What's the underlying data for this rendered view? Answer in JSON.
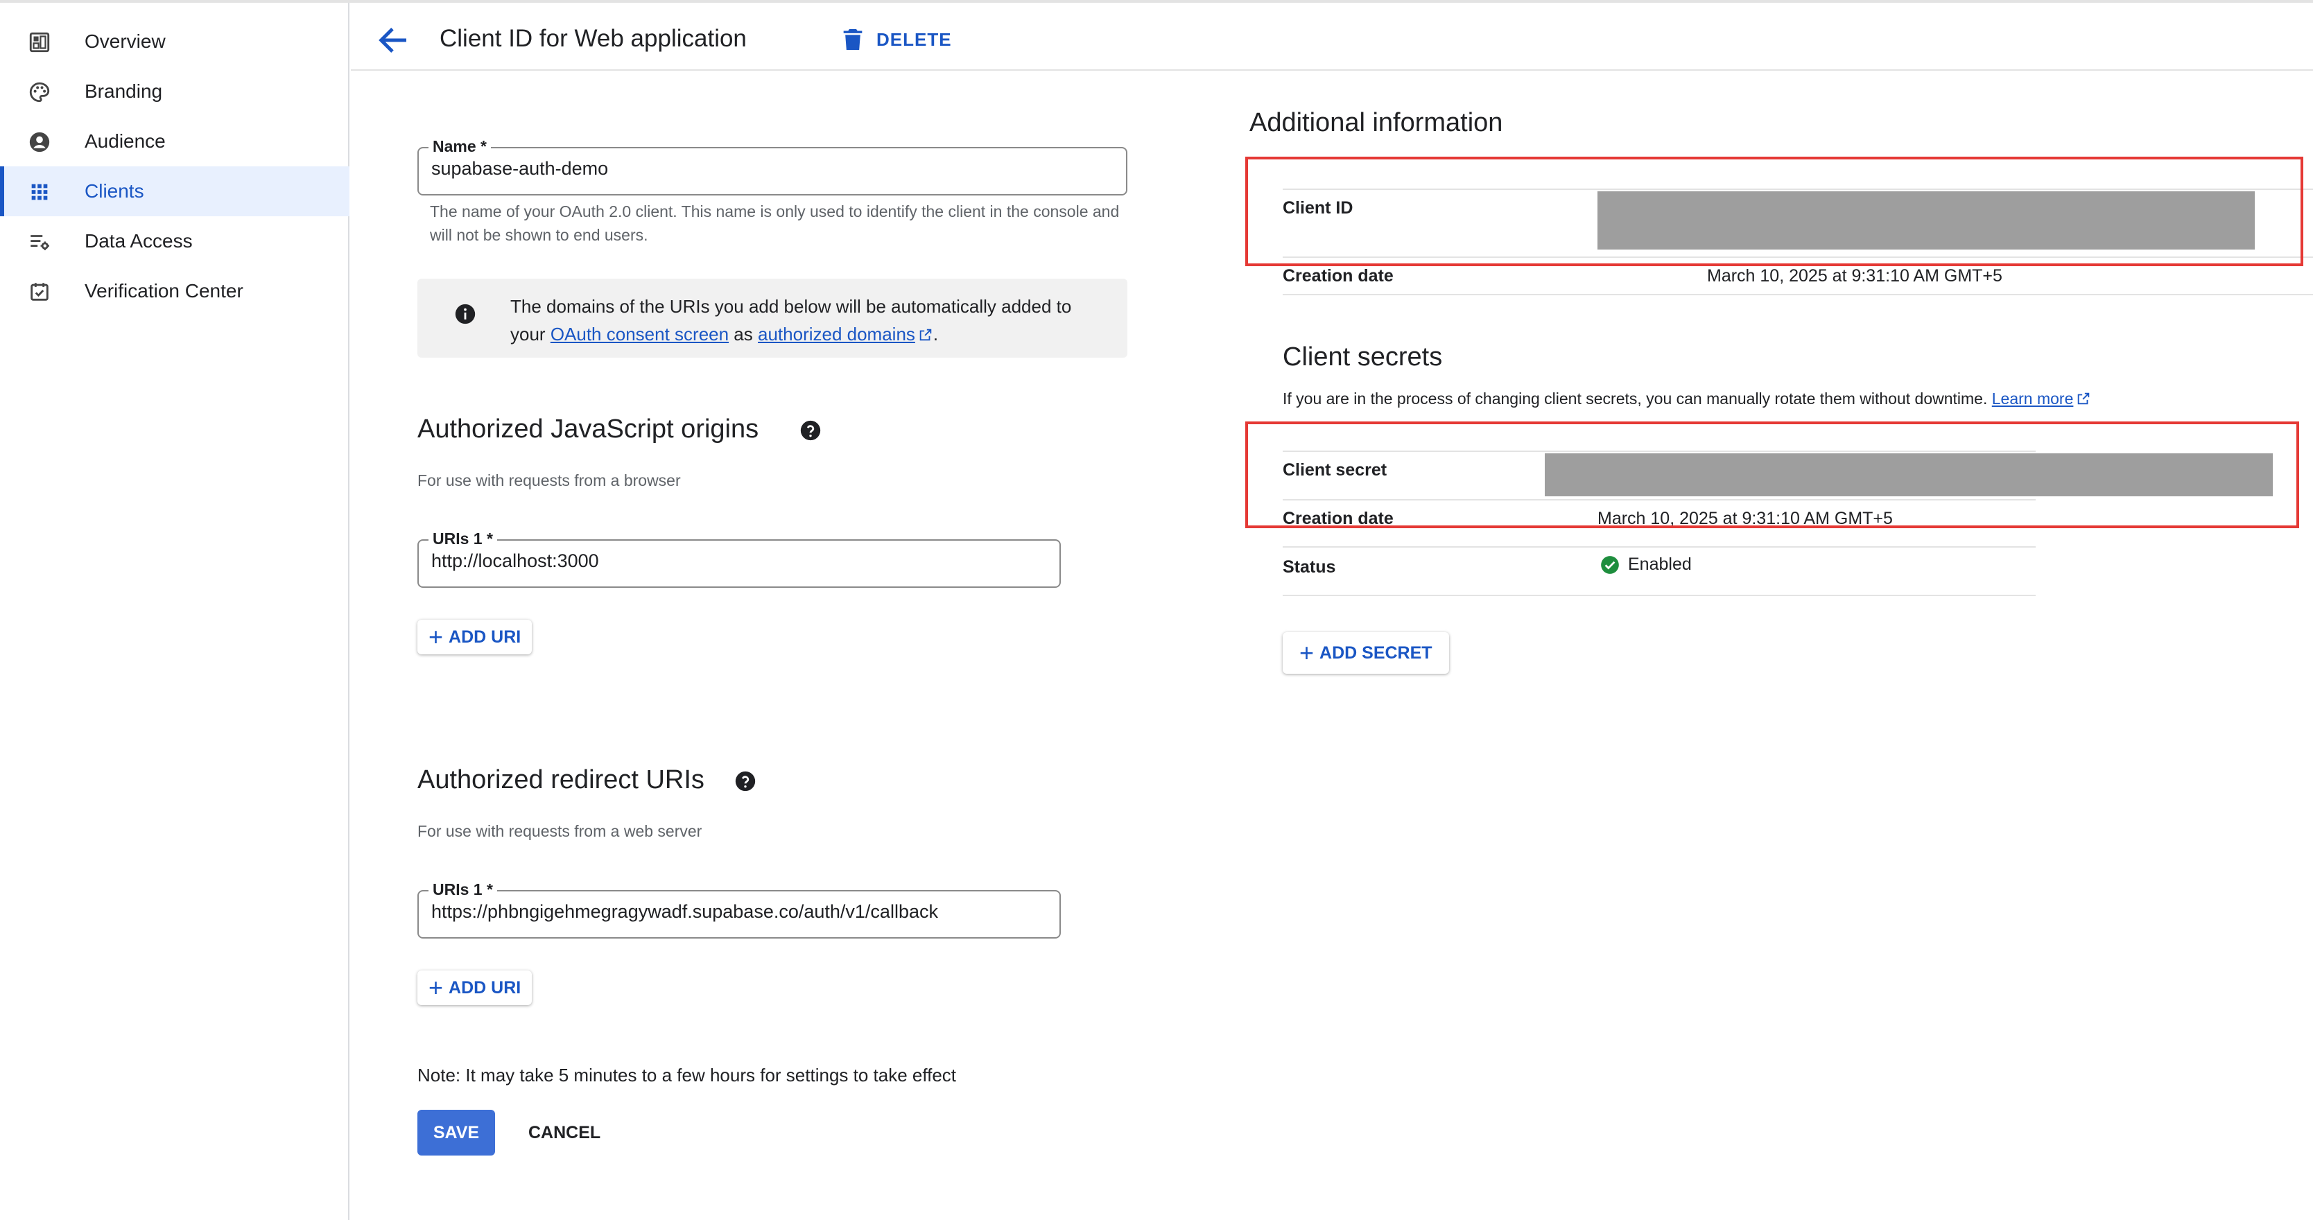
{
  "sidebar": {
    "items": [
      {
        "label": "Overview",
        "icon": "dashboard-icon"
      },
      {
        "label": "Branding",
        "icon": "palette-icon"
      },
      {
        "label": "Audience",
        "icon": "account-circle-icon"
      },
      {
        "label": "Clients",
        "icon": "apps-grid-icon",
        "active": true
      },
      {
        "label": "Data Access",
        "icon": "data-settings-icon"
      },
      {
        "label": "Verification Center",
        "icon": "verified-checkbox-icon"
      }
    ]
  },
  "header": {
    "title": "Client ID for Web application",
    "delete_label": "DELETE"
  },
  "form": {
    "name_label": "Name *",
    "name_value": "supabase-auth-demo",
    "name_help": "The name of your OAuth 2.0 client. This name is only used to identify the client in the console and will not be shown to end users.",
    "info_text_1": "The domains of the URIs you add below will be automatically added to",
    "info_text_2a": "your ",
    "info_link_1": "OAuth consent screen",
    "info_text_2b": " as ",
    "info_link_2": "authorized domains",
    "info_text_2c": ".",
    "js_origins": {
      "title": "Authorized JavaScript origins",
      "subtitle": "For use with requests from a browser",
      "uri_label": "URIs 1 *",
      "uri_value": "http://localhost:3000",
      "add_label": "ADD URI"
    },
    "redirect_uris": {
      "title": "Authorized redirect URIs",
      "subtitle": "For use with requests from a web server",
      "uri_label": "URIs 1 *",
      "uri_value": "https://phbngigehmegragywadf.supabase.co/auth/v1/callback",
      "add_label": "ADD URI"
    },
    "note": "Note: It may take 5 minutes to a few hours for settings to take effect",
    "save_label": "SAVE",
    "cancel_label": "CANCEL"
  },
  "additional_info": {
    "title": "Additional information",
    "client_id_label": "Client ID",
    "creation_date_label": "Creation date",
    "creation_date_value": "March 10, 2025 at 9:31:10 AM GMT+5"
  },
  "client_secrets": {
    "title": "Client secrets",
    "description": "If you are in the process of changing client secrets, you can manually rotate them without downtime.",
    "learn_more": "Learn more",
    "secret_label": "Client secret",
    "creation_date_label": "Creation date",
    "creation_date_value": "March 10, 2025 at 9:31:10 AM GMT+5",
    "status_label": "Status",
    "status_value": "Enabled",
    "add_secret_label": "ADD SECRET"
  },
  "colors": {
    "accent": "#1a56c4",
    "highlight_frame": "#e53935",
    "enabled_green": "#1e8e3e"
  }
}
